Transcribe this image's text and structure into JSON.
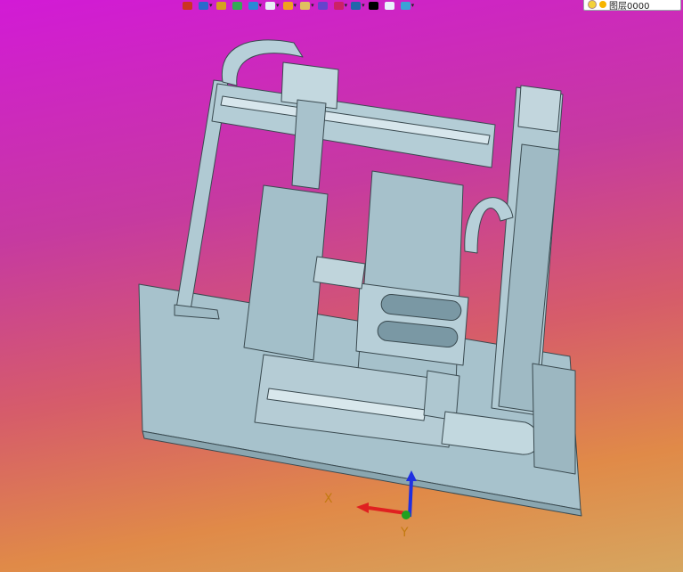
{
  "toolbar": {
    "buttons": [
      {
        "name": "history-icon",
        "color": "#cc3322",
        "caret": false
      },
      {
        "name": "view-orient-icon",
        "color": "#2a6acc",
        "caret": true
      },
      {
        "name": "pencil-icon",
        "color": "#d4a020",
        "caret": false
      },
      {
        "name": "layers-icon",
        "color": "#33aa55",
        "caret": false
      },
      {
        "name": "cube-blue-icon",
        "color": "#2a8ad6",
        "caret": true
      },
      {
        "name": "cube-white-icon",
        "color": "#e8eef6",
        "caret": true
      },
      {
        "name": "scene-icon",
        "color": "#f0a020",
        "caret": true
      },
      {
        "name": "display-mode-icon",
        "color": "#e0c060",
        "caret": true
      },
      {
        "name": "section-icon",
        "color": "#6644cc",
        "caret": false
      },
      {
        "name": "render-icon",
        "color": "#cc2266",
        "caret": true
      },
      {
        "name": "monitor-icon",
        "color": "#2266aa",
        "caret": true
      },
      {
        "name": "color-black-icon",
        "color": "#000000",
        "caret": false
      },
      {
        "name": "color-white-icon",
        "color": "#e9f1fb",
        "caret": false
      },
      {
        "name": "layers-stack-icon",
        "color": "#3aa3d6",
        "caret": true
      }
    ],
    "layer": {
      "label": "图层0000"
    }
  },
  "viewport": {
    "part_color": "#a9c4ce",
    "edge_color": "#3a4a50"
  },
  "axes": {
    "x_label": "X",
    "y_label": "Y",
    "x_color": "#e02020",
    "y_color": "#20a020",
    "z_color": "#2030e0"
  }
}
